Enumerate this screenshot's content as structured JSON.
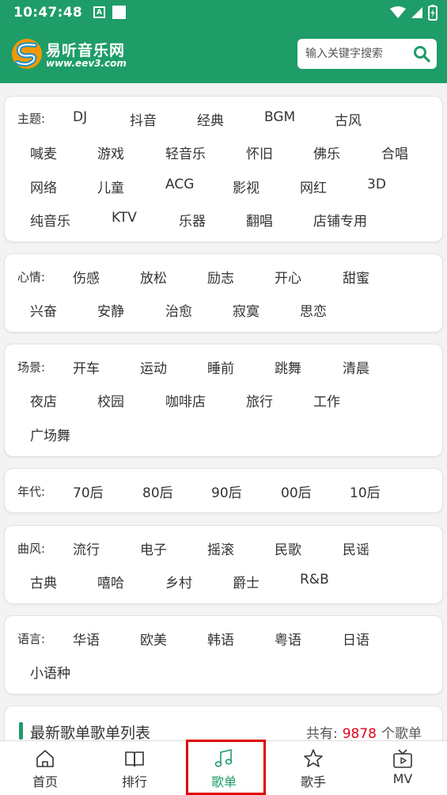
{
  "status_bar": {
    "time": "10:47:48",
    "notif_letter": "A"
  },
  "header": {
    "site_name": "易听音乐网",
    "site_url": "www.eev3.com",
    "search_placeholder": "输入关键字搜索"
  },
  "categories": [
    {
      "label": "主题:",
      "tags": [
        "DJ",
        "抖音",
        "经典",
        "BGM",
        "古风",
        "喊麦",
        "游戏",
        "轻音乐",
        "怀旧",
        "佛乐",
        "合唱",
        "网络",
        "儿童",
        "ACG",
        "影视",
        "网红",
        "3D",
        "纯音乐",
        "KTV",
        "乐器",
        "翻唱",
        "店铺专用"
      ]
    },
    {
      "label": "心情:",
      "tags": [
        "伤感",
        "放松",
        "励志",
        "开心",
        "甜蜜",
        "兴奋",
        "安静",
        "治愈",
        "寂寞",
        "思恋"
      ]
    },
    {
      "label": "场景:",
      "tags": [
        "开车",
        "运动",
        "睡前",
        "跳舞",
        "清晨",
        "夜店",
        "校园",
        "咖啡店",
        "旅行",
        "工作",
        "广场舞"
      ]
    },
    {
      "label": "年代:",
      "tags": [
        "70后",
        "80后",
        "90后",
        "00后",
        "10后"
      ]
    },
    {
      "label": "曲风:",
      "tags": [
        "流行",
        "电子",
        "摇滚",
        "民歌",
        "民谣",
        "古典",
        "嘻哈",
        "乡村",
        "爵士",
        "R&B"
      ]
    },
    {
      "label": "语言:",
      "tags": [
        "华语",
        "欧美",
        "韩语",
        "粤语",
        "日语",
        "小语种"
      ]
    }
  ],
  "playlist_section": {
    "title": "最新歌单歌单列表",
    "count_prefix": "共有:",
    "count": "9878",
    "count_suffix": "个歌单"
  },
  "nav": [
    {
      "label": "首页",
      "icon": "home-icon"
    },
    {
      "label": "排行",
      "icon": "book-icon"
    },
    {
      "label": "歌单",
      "icon": "music-note-icon",
      "active": true
    },
    {
      "label": "歌手",
      "icon": "star-icon"
    },
    {
      "label": "MV",
      "icon": "tv-icon"
    }
  ],
  "colors": {
    "brand": "#1e9d68",
    "count": "#e0001a",
    "highlight": "#e00000"
  }
}
